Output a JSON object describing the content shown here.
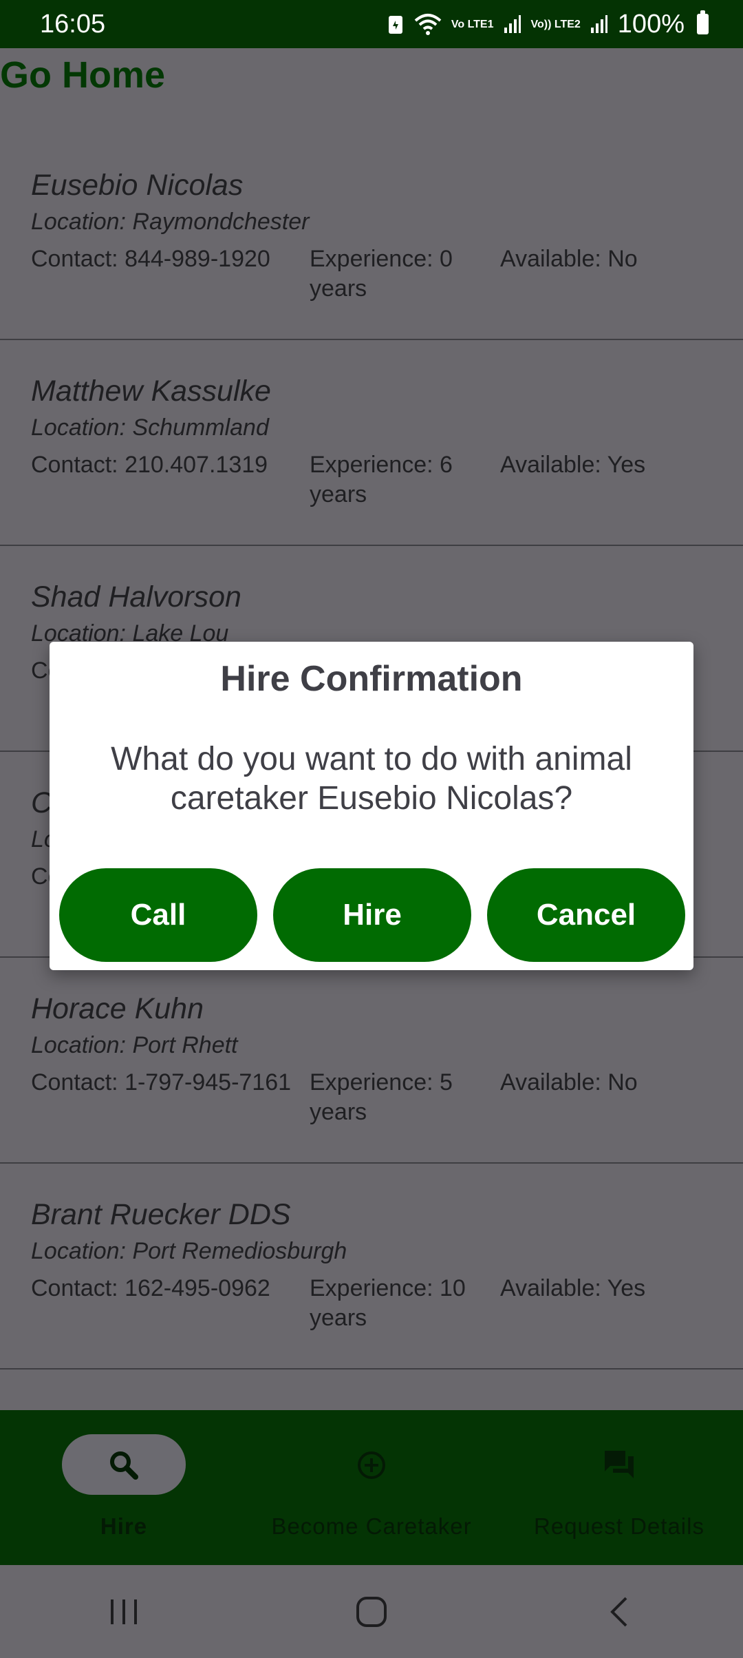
{
  "status_bar": {
    "time": "16:05",
    "battery": "100%",
    "net1": "Vo LTE1",
    "net2": "Vo)) LTE2"
  },
  "header": {
    "title": "Go Home"
  },
  "caretakers": [
    {
      "name": "Eusebio Nicolas",
      "location": "Location: Raymondchester",
      "contact": "Contact: 844-989-1920",
      "experience": "Experience: 0 years",
      "available": "Available: No"
    },
    {
      "name": "Matthew Kassulke",
      "location": "Location: Schummland",
      "contact": "Contact: 210.407.1319",
      "experience": "Experience: 6 years",
      "available": "Available: Yes"
    },
    {
      "name": "Shad Halvorson",
      "location": "Location: Lake Lou",
      "contact": "Co",
      "experience": "",
      "available": ""
    },
    {
      "name": "C",
      "location": "Lo",
      "contact": "Co",
      "experience": "",
      "available": ""
    },
    {
      "name": "Horace Kuhn",
      "location": "Location: Port Rhett",
      "contact": "Contact: 1-797-945-7161",
      "experience": "Experience: 5 years",
      "available": "Available: No"
    },
    {
      "name": "Brant Ruecker DDS",
      "location": "Location: Port Remediosburgh",
      "contact": "Contact: 162-495-0962",
      "experience": "Experience: 10 years",
      "available": "Available: Yes"
    }
  ],
  "dialog": {
    "title": "Hire Confirmation",
    "message": "What do you want to do with animal caretaker Eusebio Nicolas?",
    "call_label": "Call",
    "hire_label": "Hire",
    "cancel_label": "Cancel"
  },
  "bottom_nav": {
    "items": [
      {
        "label": "Hire",
        "icon": "search-icon",
        "active": true
      },
      {
        "label": "Become Caretaker",
        "icon": "add-circle-icon",
        "active": false
      },
      {
        "label": "Request Details",
        "icon": "chat-icon",
        "active": false
      }
    ]
  },
  "colors": {
    "primary": "#016b02",
    "dark_green": "#043404",
    "scrim": "#6a686d"
  }
}
